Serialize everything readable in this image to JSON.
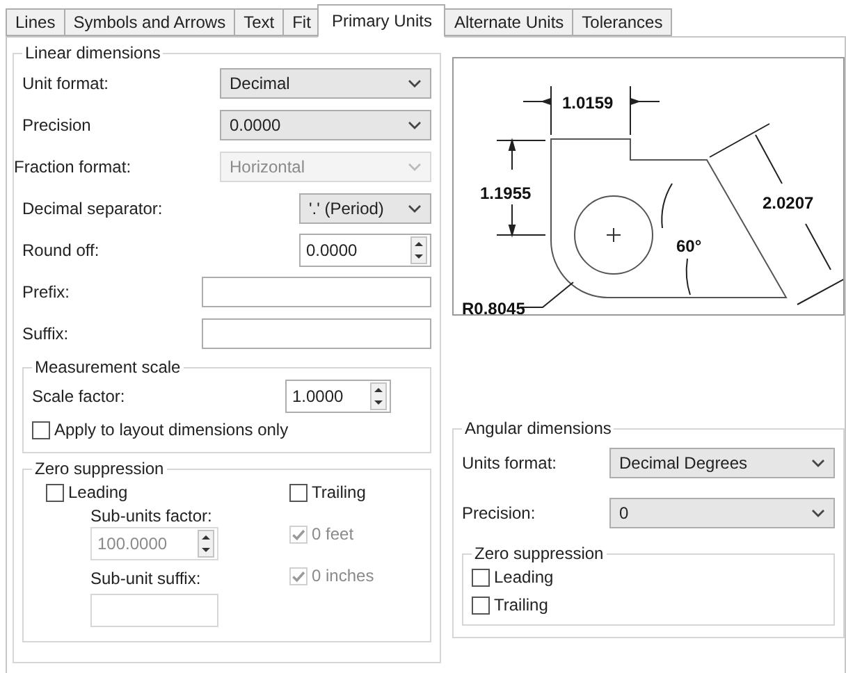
{
  "tabs": [
    {
      "label": "Lines",
      "selected": false
    },
    {
      "label": "Symbols and Arrows",
      "selected": false
    },
    {
      "label": "Text",
      "selected": false
    },
    {
      "label": "Fit",
      "selected": false
    },
    {
      "label": "Primary Units",
      "selected": true
    },
    {
      "label": "Alternate Units",
      "selected": false
    },
    {
      "label": "Tolerances",
      "selected": false
    }
  ],
  "linear_dimensions": {
    "title": "Linear dimensions",
    "fields": [
      {
        "kind": "select",
        "label": "Unit format:",
        "value": "Decimal",
        "disabled": false
      },
      {
        "kind": "select",
        "label": "Precision",
        "value": "0.0000",
        "disabled": false
      },
      {
        "kind": "select",
        "label": "Fraction format:",
        "value": "Horizontal",
        "disabled": true
      },
      {
        "kind": "select",
        "label": "Decimal separator:",
        "value": "'.' (Period)",
        "disabled": false
      },
      {
        "kind": "spin",
        "label": "Round off:",
        "value": "0.0000",
        "disabled": false
      },
      {
        "kind": "text",
        "label": "Prefix:",
        "disabled": false
      },
      {
        "kind": "text",
        "label": "Suffix:",
        "disabled": false
      }
    ],
    "measurement_scale": {
      "title": "Measurement scale",
      "scale_label": "Scale factor:",
      "scale_value": "1.0000",
      "apply": {
        "label": "Apply to layout dimensions only",
        "checked": false
      }
    },
    "zero_suppression": {
      "title": "Zero suppression",
      "leading": {
        "label": "Leading",
        "checked": false
      },
      "trailing": {
        "label": "Trailing",
        "checked": false
      },
      "sub_units_factor": {
        "label": "Sub-units factor:",
        "value": "100.0000",
        "disabled": true
      },
      "sub_unit_suffix": {
        "label": "Sub-unit suffix:",
        "disabled": true
      },
      "feet": {
        "label": "0 feet",
        "checked": true,
        "disabled": true
      },
      "inches": {
        "label": "0 inches",
        "checked": true,
        "disabled": true
      }
    }
  },
  "preview": {
    "labels": [
      "1.0159",
      "1.1955",
      "2.0207",
      "60°",
      "R0.8045"
    ]
  },
  "angular_dimensions": {
    "title": "Angular dimensions",
    "fields": [
      {
        "kind": "select",
        "label": "Units format:",
        "value": "Decimal Degrees",
        "disabled": false
      },
      {
        "kind": "select",
        "label": "Precision:",
        "value": "0",
        "disabled": false
      }
    ],
    "zero_suppression": {
      "title": "Zero suppression",
      "checkboxes": [
        {
          "label": "Leading",
          "checked": false
        },
        {
          "label": "Trailing",
          "checked": false
        }
      ]
    }
  }
}
